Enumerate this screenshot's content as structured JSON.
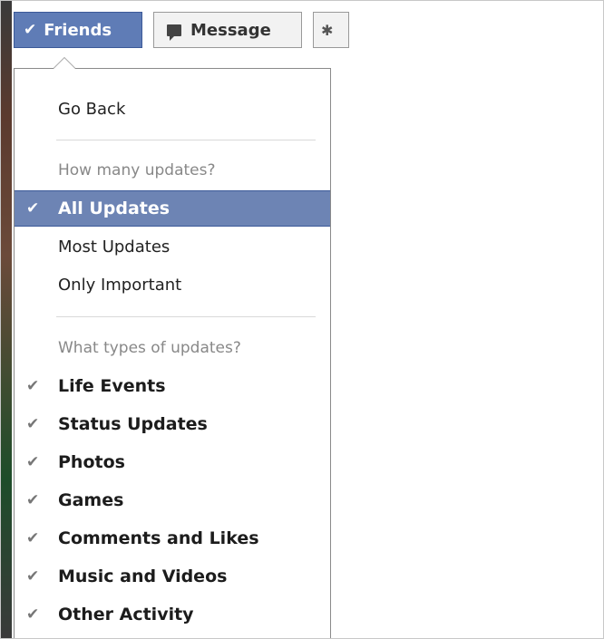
{
  "header": {
    "friends_label": "Friends",
    "message_label": "Message",
    "more_glyph": "✱"
  },
  "menu": {
    "go_back": "Go Back",
    "updates_header": "How many updates?",
    "update_options": [
      {
        "label": "All Updates",
        "selected": true
      },
      {
        "label": "Most Updates",
        "selected": false
      },
      {
        "label": "Only Important",
        "selected": false
      }
    ],
    "types_header": "What types of updates?",
    "type_options": [
      {
        "label": "Life Events",
        "checked": true
      },
      {
        "label": "Status Updates",
        "checked": true
      },
      {
        "label": "Photos",
        "checked": true
      },
      {
        "label": "Games",
        "checked": true
      },
      {
        "label": "Comments and Likes",
        "checked": true
      },
      {
        "label": "Music and Videos",
        "checked": true
      },
      {
        "label": "Other Activity",
        "checked": true
      }
    ]
  },
  "colors": {
    "accent": "#6d84b4",
    "accent_border": "#3b5998",
    "check_gray": "#777777"
  },
  "icons": {
    "check": "✔",
    "message": "speech-bubble-icon"
  }
}
